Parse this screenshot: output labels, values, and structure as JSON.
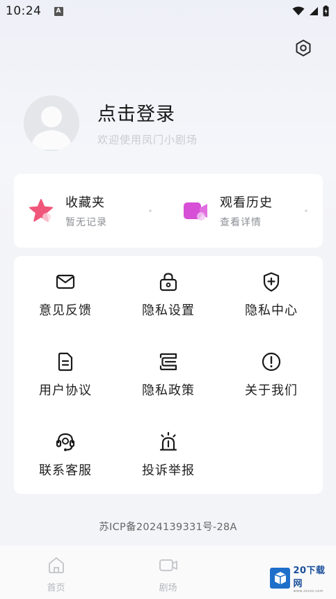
{
  "status_bar": {
    "time": "10:24",
    "notification_letter": "A"
  },
  "profile": {
    "title": "点击登录",
    "subtitle": "欢迎使用凤门小剧场"
  },
  "quick": [
    {
      "title": "收藏夹",
      "subtitle": "暂无记录",
      "icon": "star-icon",
      "color": "#f0567a"
    },
    {
      "title": "观看历史",
      "subtitle": "查看详情",
      "icon": "video-icon",
      "color": "#d64fd6"
    }
  ],
  "grid": [
    {
      "label": "意见反馈",
      "icon": "mail-icon"
    },
    {
      "label": "隐私设置",
      "icon": "lock-icon"
    },
    {
      "label": "隐私中心",
      "icon": "shield-plus-icon"
    },
    {
      "label": "用户协议",
      "icon": "document-icon"
    },
    {
      "label": "隐私政策",
      "icon": "policy-icon"
    },
    {
      "label": "关于我们",
      "icon": "info-icon"
    },
    {
      "label": "联系客服",
      "icon": "headset-icon"
    },
    {
      "label": "投诉举报",
      "icon": "alarm-icon"
    }
  ],
  "icp": "苏ICP备2024139331号-28A",
  "nav": [
    {
      "label": "首页",
      "icon": "home-icon"
    },
    {
      "label": "剧场",
      "icon": "theater-icon"
    },
    {
      "label": "",
      "icon": ""
    }
  ],
  "watermark": {
    "main": "20下载网",
    "sub": "www.zxxzz.com"
  }
}
